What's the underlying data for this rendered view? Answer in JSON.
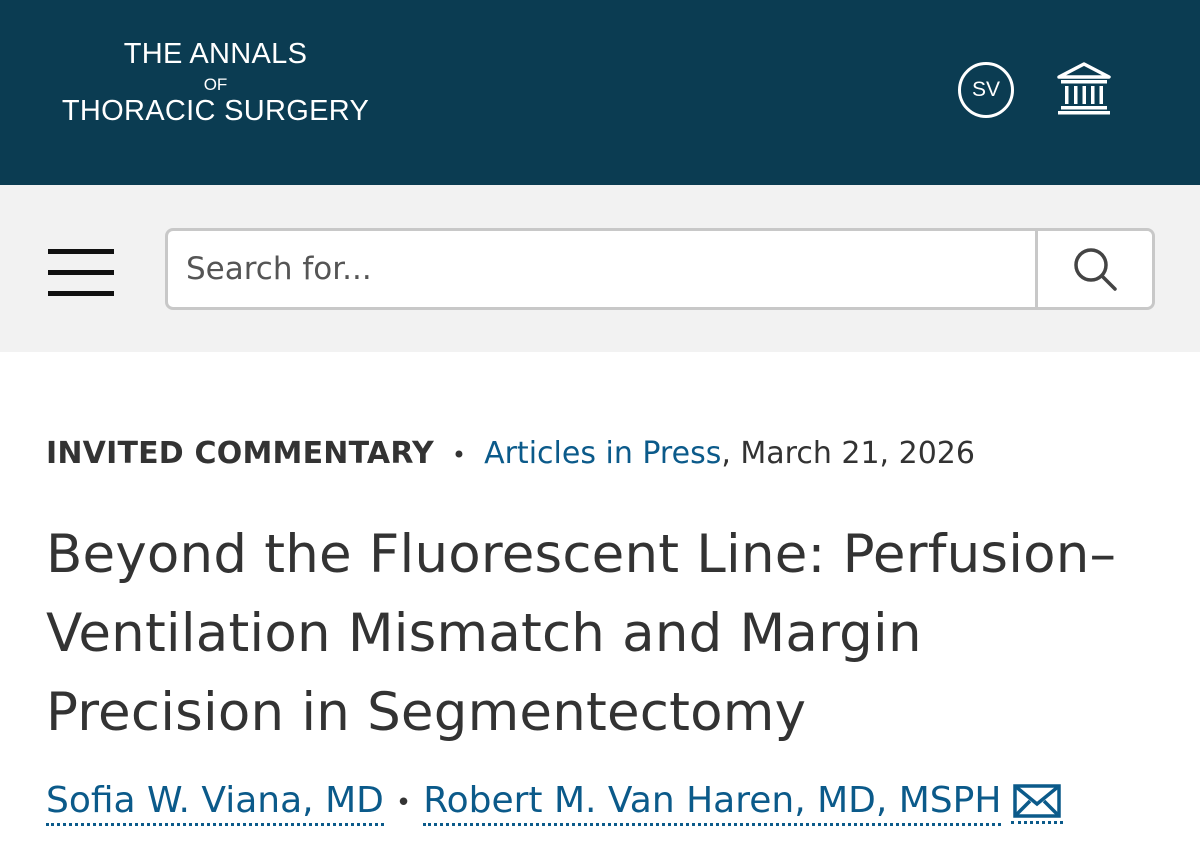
{
  "header": {
    "logo_line1": "THE ANNALS",
    "logo_line2": "OF",
    "logo_line3": "THORACIC SURGERY",
    "user_initials": "SV",
    "institution_icon": "institution-icon"
  },
  "search": {
    "menu_icon": "hamburger-menu-icon",
    "placeholder": "Search for...",
    "value": "",
    "search_icon": "search-icon"
  },
  "article": {
    "type": "INVITED COMMENTARY",
    "separator": "•",
    "section_link": "Articles in Press",
    "date": ", March 21, 2026",
    "title": "Beyond the Fluorescent Line: Perfusion–Ventilation Mismatch and Margin Precision in Segmentectomy",
    "authors": [
      {
        "name": "Sofia W. Viana, MD"
      },
      {
        "name": "Robert M. Van Haren, MD, MSPH"
      }
    ],
    "author_separator": "•",
    "email_icon": "email-icon"
  },
  "colors": {
    "header_bg": "#0b3c52",
    "search_strip_bg": "#f2f2f2",
    "link": "#0b5a8a",
    "text": "#333333"
  }
}
